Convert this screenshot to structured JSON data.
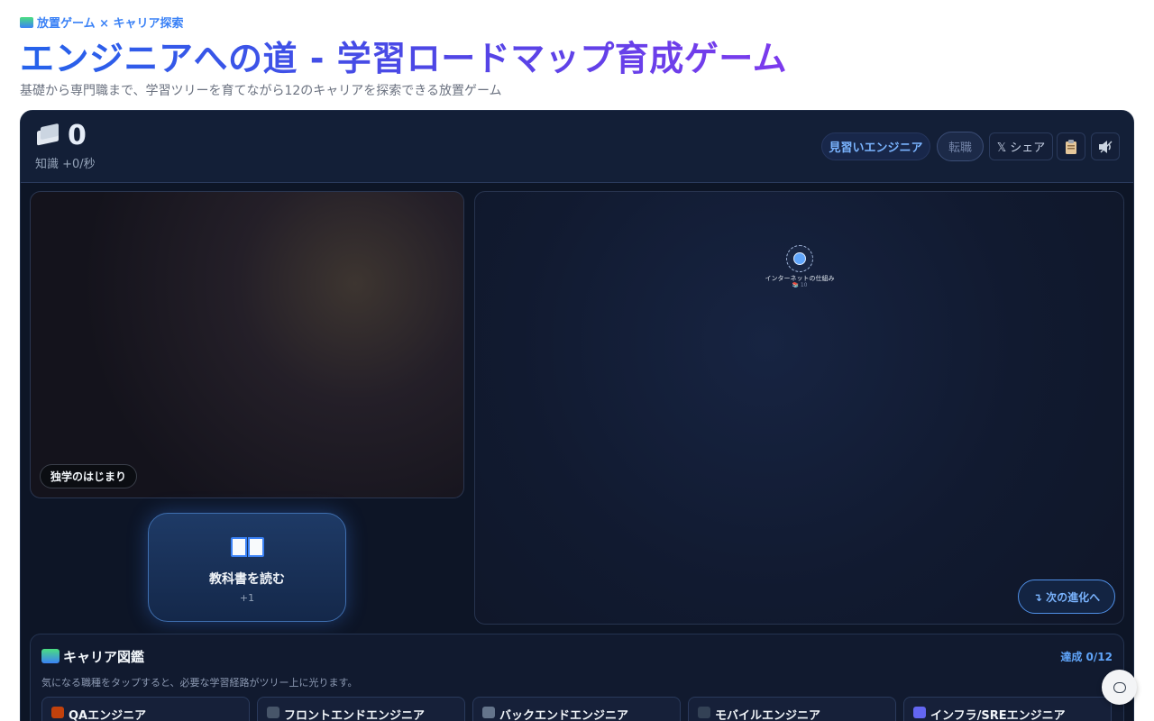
{
  "page": {
    "eyebrow": "放置ゲーム × キャリア探索",
    "title": "エンジニアへの道 - 学習ロードマップ育成ゲーム",
    "subtitle": "基礎から専門職まで、学習ツリーを育てながら12のキャリアを探索できる放置ゲーム"
  },
  "hud": {
    "knowledge": "0",
    "rate": "知識 +0/秒",
    "rank": "見習いエンジニア",
    "change_job": "転職",
    "share": "𝕏 シェア",
    "clipboard_icon": "clipboard-icon",
    "sound_icon": "speaker-icon"
  },
  "scene": {
    "stage": "独学のはじまり"
  },
  "read": {
    "label": "教科書を読む",
    "gain": "+1"
  },
  "tree": {
    "nodes": [
      {
        "label": "インターネットの仕組み",
        "cost": "📚 10"
      }
    ],
    "next": "↴ 次の進化へ"
  },
  "dex": {
    "title": "キャリア図鑑",
    "count": "達成 0/12",
    "hint": "気になる職種をタップすると、必要な学習経路がツリー上に光ります。",
    "cards": [
      {
        "label": "QAエンジニア",
        "color": "#c2410c"
      },
      {
        "label": "フロントエンドエンジニア",
        "color": "#475569"
      },
      {
        "label": "バックエンドエンジニア",
        "color": "#64748b"
      },
      {
        "label": "モバイルエンジニア",
        "color": "#334155"
      },
      {
        "label": "インフラ/SREエンジニア",
        "color": "#6366f1"
      }
    ]
  }
}
